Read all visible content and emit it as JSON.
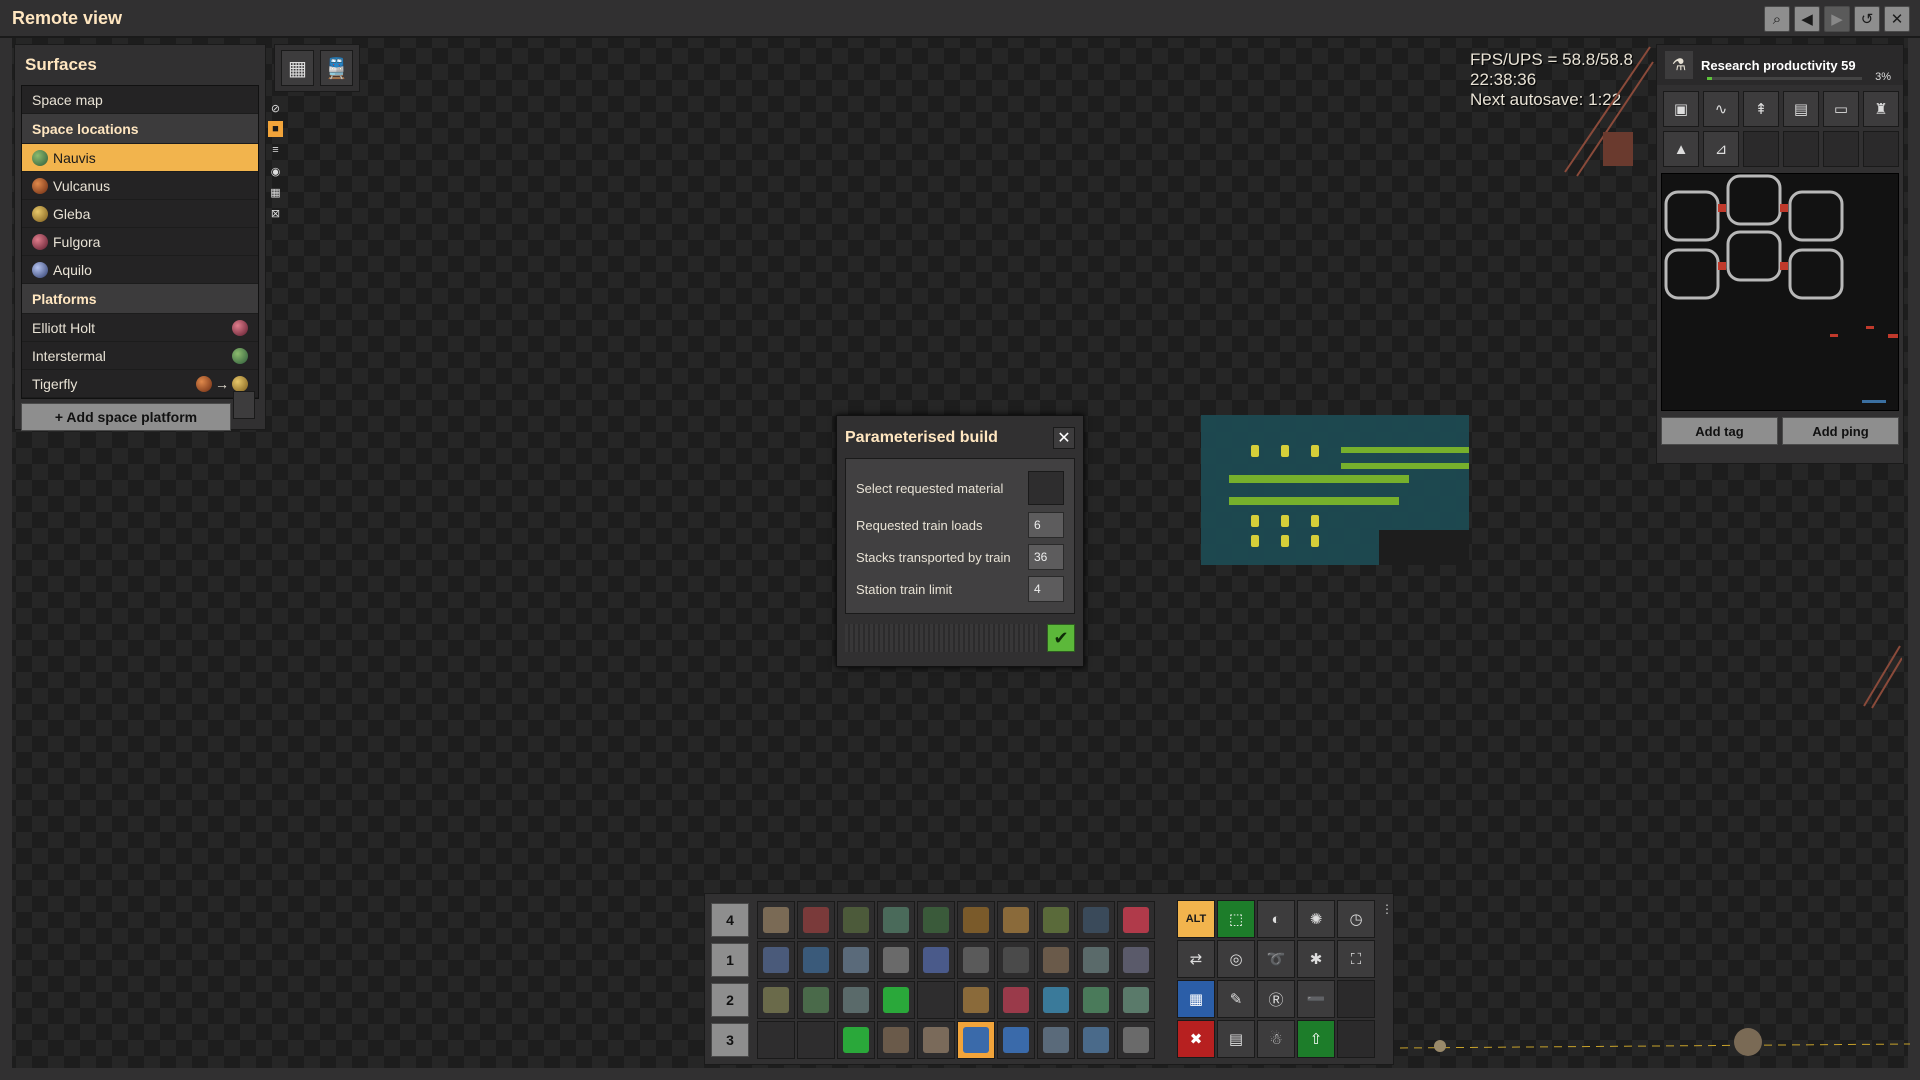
{
  "window": {
    "title": "Remote view",
    "buttons": [
      "search",
      "back",
      "forward",
      "refresh",
      "close"
    ]
  },
  "surfaces": {
    "title": "Surfaces",
    "space_map": "Space map",
    "space_locations_header": "Space locations",
    "locations": [
      {
        "name": "Nauvis",
        "color": "#5c8a4a",
        "selected": true
      },
      {
        "name": "Vulcanus",
        "color": "#b5522a",
        "selected": false
      },
      {
        "name": "Gleba",
        "color": "#b89a3d",
        "selected": false
      },
      {
        "name": "Fulgora",
        "color": "#a33a55",
        "selected": false
      },
      {
        "name": "Aquilo",
        "color": "#5b6fa8",
        "selected": false
      }
    ],
    "platforms_header": "Platforms",
    "platforms": [
      {
        "name": "Elliott Holt",
        "icon": "fulgora-planet-icon"
      },
      {
        "name": "Interstermal",
        "icon": "nauvis-planet-icon"
      },
      {
        "name": "Tigerfly",
        "icon": "vulcanus-to-gleba-route-icon",
        "route": "→"
      }
    ],
    "add_button": "+ Add space platform"
  },
  "overlay": {
    "fps_line": "FPS/UPS = 58.8/58.8",
    "time": "22:38:36",
    "autosave": "Next autosave: 1:22"
  },
  "research": {
    "title": "Research productivity 59",
    "percent_label": "3%",
    "progress": 0.03,
    "add_tag": "Add tag",
    "add_ping": "Add ping"
  },
  "dialog": {
    "title": "Parameterised build",
    "fields": [
      {
        "label": "Select requested material",
        "value": "",
        "kind": "slot"
      },
      {
        "label": "Requested train loads",
        "value": "6",
        "kind": "number"
      },
      {
        "label": "Stacks transported by train",
        "value": "36",
        "kind": "number"
      },
      {
        "label": "Station train limit",
        "value": "4",
        "kind": "number"
      }
    ]
  },
  "hotbar": {
    "rows": [
      "4",
      "1",
      "2",
      "3"
    ],
    "quick_access_alt_label": "ALT"
  }
}
